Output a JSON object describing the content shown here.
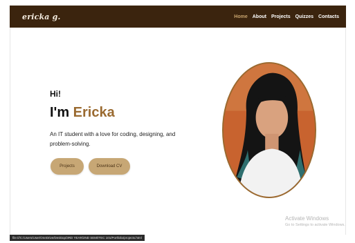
{
  "navbar": {
    "logo": "ericka g.",
    "links": [
      "Home",
      "About",
      "Projects",
      "Quizzes",
      "Contacts"
    ],
    "active_index": 0,
    "accent_color": "#c9a56f",
    "background_color": "#3b240e"
  },
  "hero": {
    "greeting": "Hi!",
    "headline_prefix": "I'm",
    "name": "Ericka",
    "description": "An IT student with a love for coding, designing, and problem-solving.",
    "buttons": {
      "projects": "Projects",
      "download_cv": "Download CV"
    },
    "name_color": "#9a6a30",
    "button_color": "#c7a775"
  },
  "windows_watermark": {
    "title": "Activate Windows",
    "subtitle": "Go to Settings to activate Windows."
  },
  "status_bar": {
    "url": "file:///C:/Users/User/OneDrive/Desktop/3RD YEAR/2ND SEM/ITEC 101/Portfolio/projects.html"
  }
}
